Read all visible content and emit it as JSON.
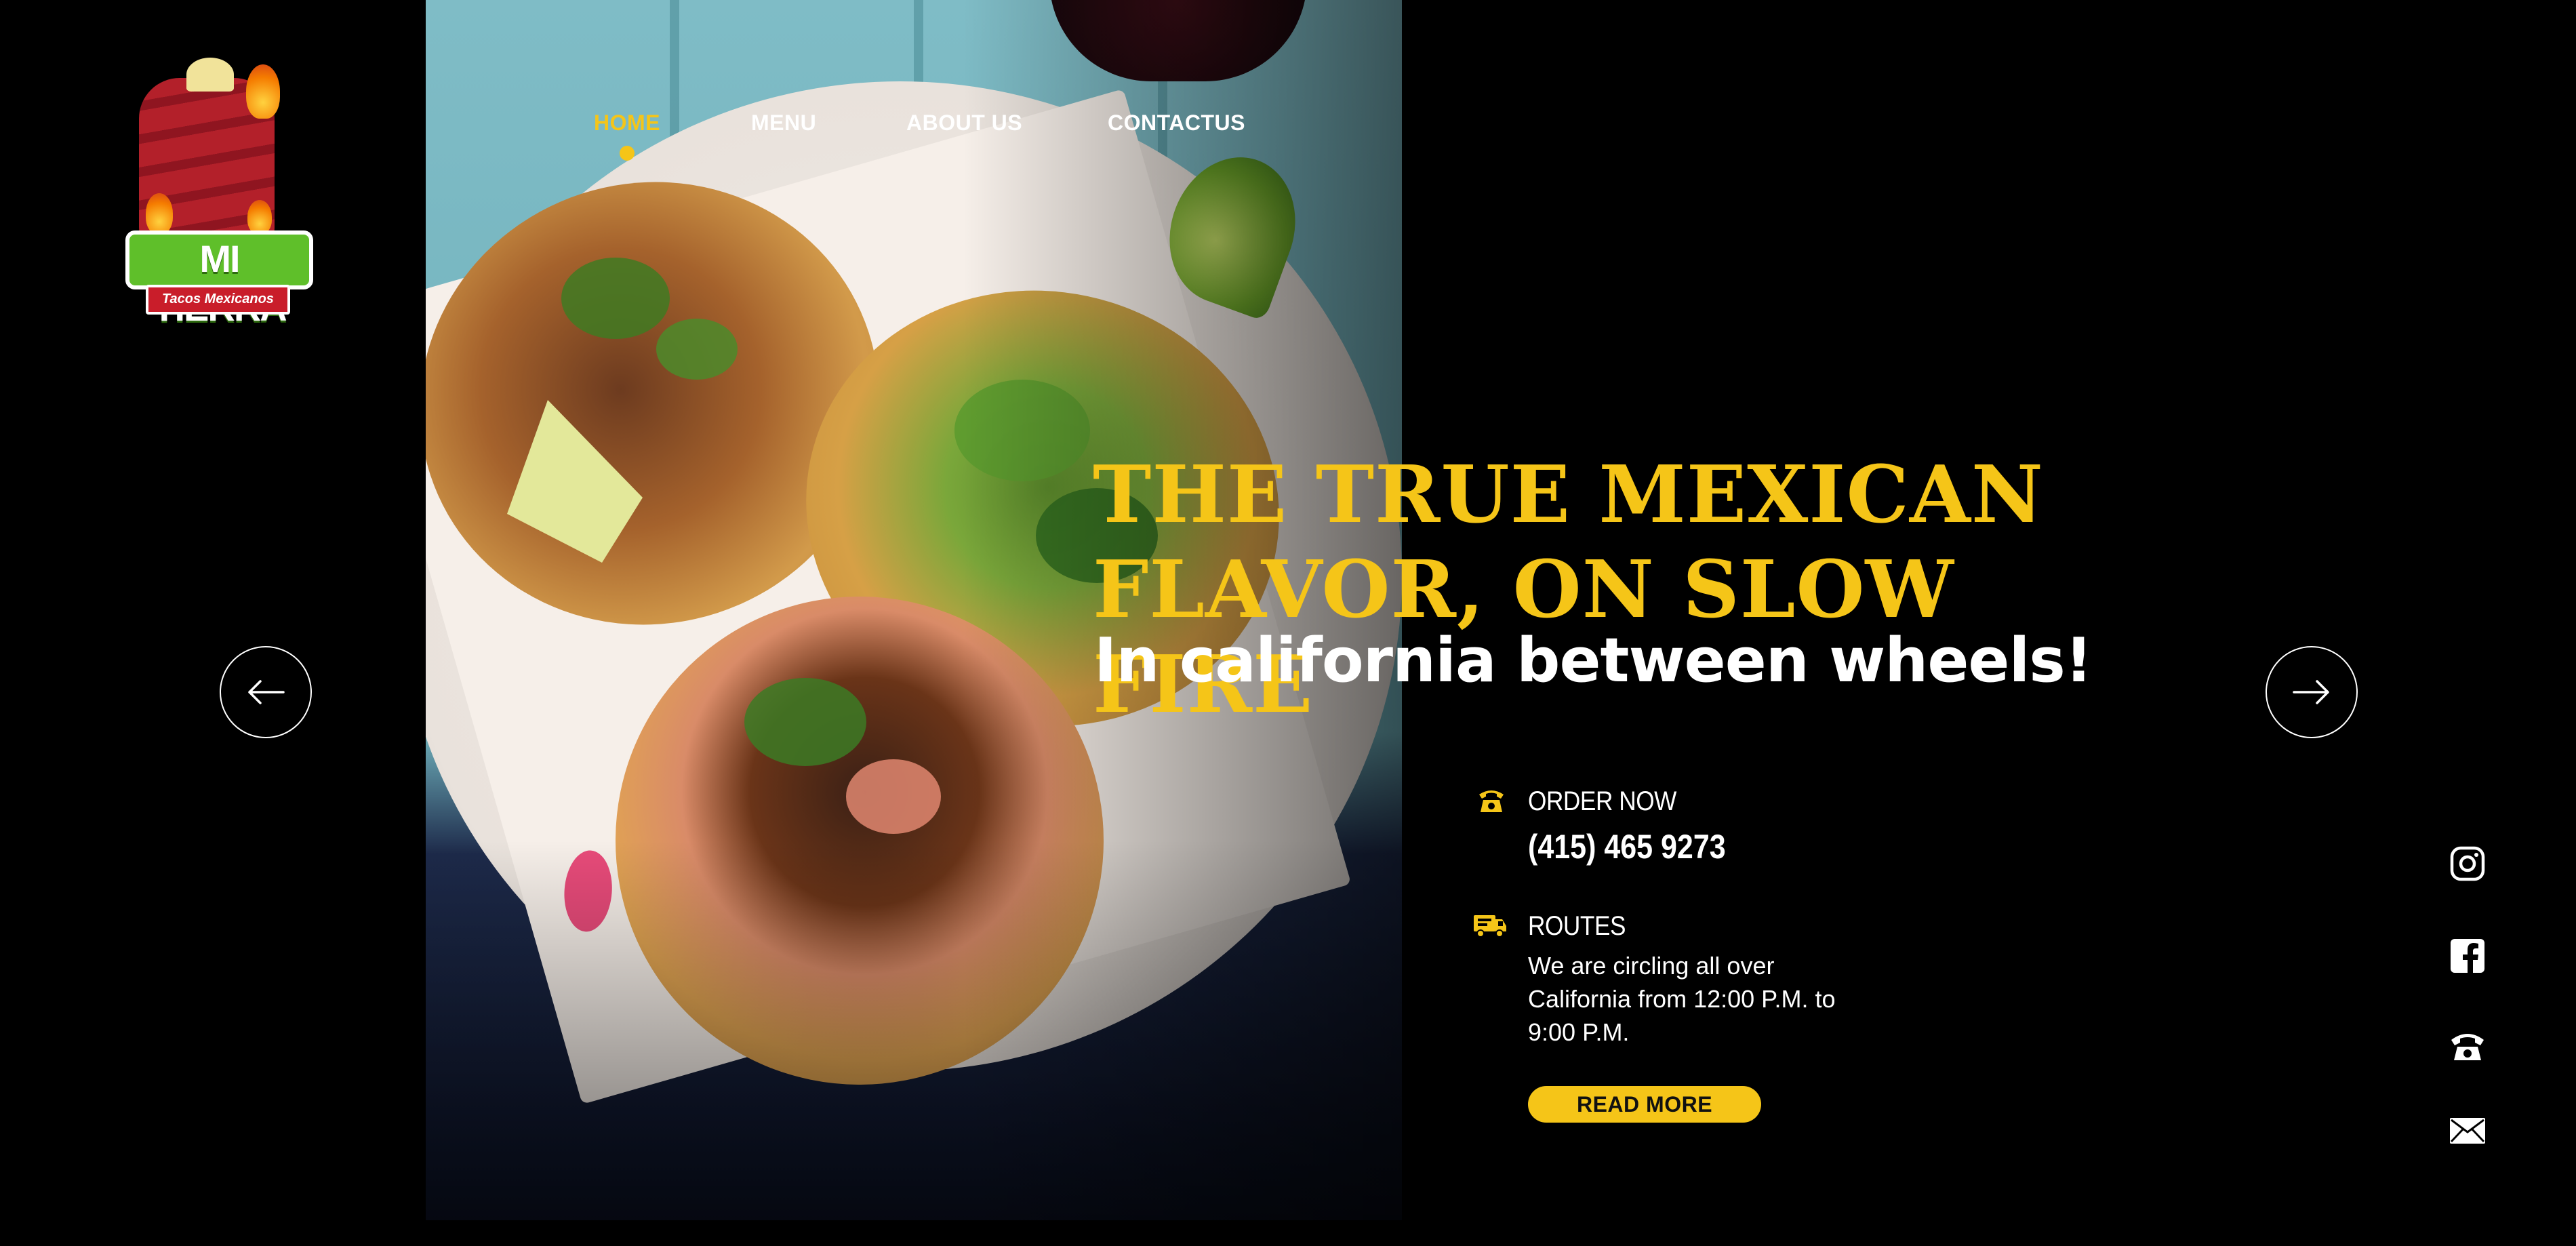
{
  "brand": {
    "logo_word": "MI TIERRA",
    "logo_tagline": "Tacos Mexicanos"
  },
  "nav": {
    "items": [
      {
        "label": "HOME",
        "active": true
      },
      {
        "label": "MENU",
        "active": false
      },
      {
        "label": "ABOUT US",
        "active": false
      },
      {
        "label": "CONTACTUS",
        "active": false
      }
    ]
  },
  "hero": {
    "headline_line1": "THE TRUE MEXICAN",
    "headline_line2": "FLAVOR, ON SLOW FIRE",
    "subline": "In california between wheels!"
  },
  "order": {
    "heading": "ORDER NOW",
    "phone": "(415) 465 9273",
    "icon": "telephone-icon"
  },
  "routes": {
    "heading": "ROUTES",
    "text": "We are circling all over California from 12:00 P.M. to 9:00 P.M.",
    "icon": "food-truck-icon"
  },
  "cta": {
    "label": "READ MORE"
  },
  "carousel": {
    "prev_icon": "arrow-left-icon",
    "next_icon": "arrow-right-icon"
  },
  "social": [
    "instagram-icon",
    "facebook-icon",
    "telephone-icon",
    "mail-icon"
  ],
  "colors": {
    "accent": "#f5c518",
    "background": "#000000",
    "text": "#ffffff"
  }
}
